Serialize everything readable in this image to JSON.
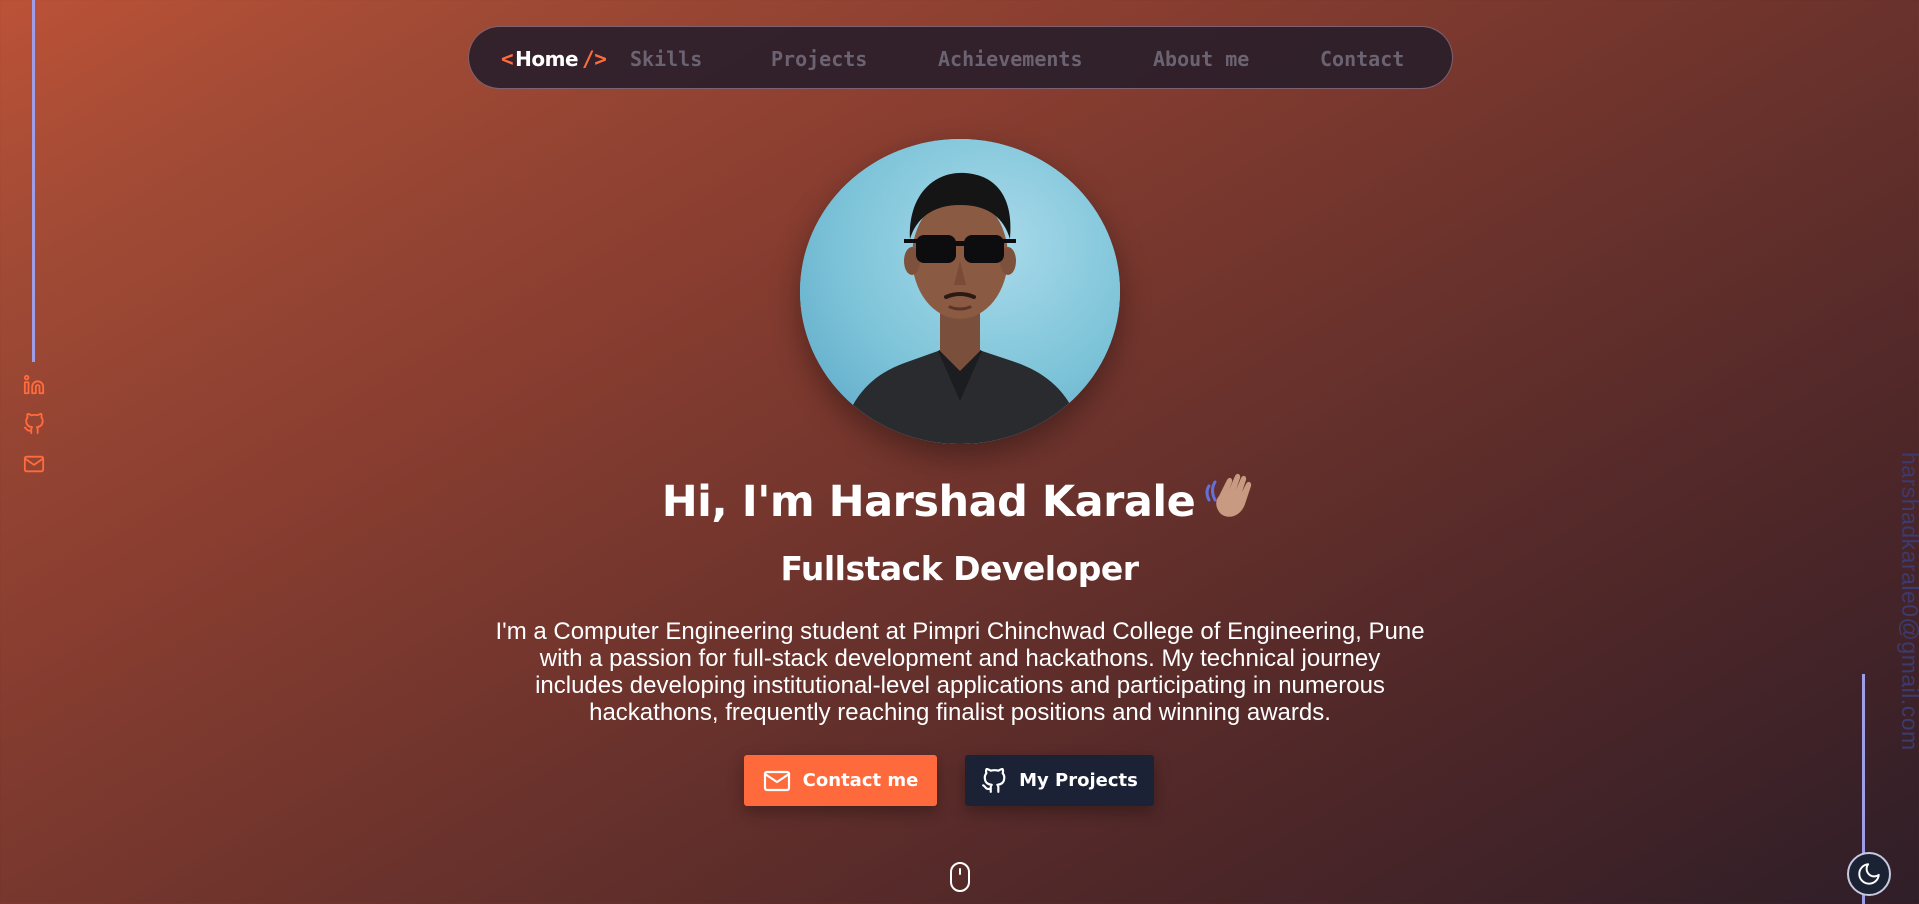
{
  "nav": {
    "home_open": "<",
    "home_label": "Home",
    "home_close": "/>",
    "items": [
      "Skills",
      "Projects",
      "Achievements",
      "About me",
      "Contact"
    ]
  },
  "social": {
    "icons": [
      "linkedin-icon",
      "github-icon",
      "mail-icon"
    ],
    "accent": "#ff6b3d"
  },
  "sidebar_right": {
    "email": "harshadkarale0@gmail.com",
    "theme_icon": "moon-icon"
  },
  "hero": {
    "avatar_icon": "profile-photo",
    "title": "Hi, I'm Harshad Karale",
    "wave_icon": "waving-hand-icon",
    "subtitle": "Fullstack Developer",
    "description": "I'm a Computer Engineering student at Pimpri Chinchwad College of Engineering, Pune with a passion for full-stack development and hackathons. My technical journey includes developing institutional-level applications and participating in numerous hackathons, frequently reaching finalist positions and winning awards.",
    "contact_button": "Contact me",
    "projects_button": "My Projects",
    "scroll_icon": "mouse-scroll-icon"
  },
  "colors": {
    "accent": "#ff6a3d",
    "dark_button": "#1c2236",
    "line": "#9f9ce8",
    "nav_inactive": "#6b6371"
  }
}
